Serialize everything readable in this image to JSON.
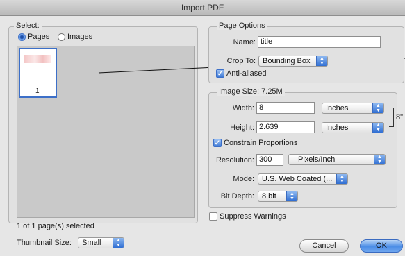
{
  "window": {
    "title": "Import PDF"
  },
  "select_panel": {
    "legend": "Select:",
    "radio_pages": "Pages",
    "radio_images": "Images",
    "thumbnail_number": "1",
    "selection_status": "1 of 1 page(s) selected",
    "thumbnail_size_label": "Thumbnail Size:",
    "thumbnail_size_value": "Small"
  },
  "page_options": {
    "legend": "Page Options",
    "name_label": "Name:",
    "name_value": "title",
    "crop_label": "Crop To:",
    "crop_value": "Bounding Box",
    "anti_aliased_label": "Anti-aliased"
  },
  "image_size": {
    "legend": "Image Size: 7.25M",
    "width_label": "Width:",
    "width_value": "8",
    "width_unit": "Inches",
    "height_label": "Height:",
    "height_value": "2.639",
    "height_unit": "Inches",
    "side_text": "8\"",
    "constrain_label": "Constrain Proportions",
    "resolution_label": "Resolution:",
    "resolution_value": "300",
    "resolution_unit": "Pixels/Inch",
    "mode_label": "Mode:",
    "mode_value": "U.S. Web Coated (...",
    "bit_depth_label": "Bit Depth:",
    "bit_depth_value": "8 bit"
  },
  "suppress_warnings_label": "Suppress Warnings",
  "buttons": {
    "cancel": "Cancel",
    "ok": "OK"
  }
}
